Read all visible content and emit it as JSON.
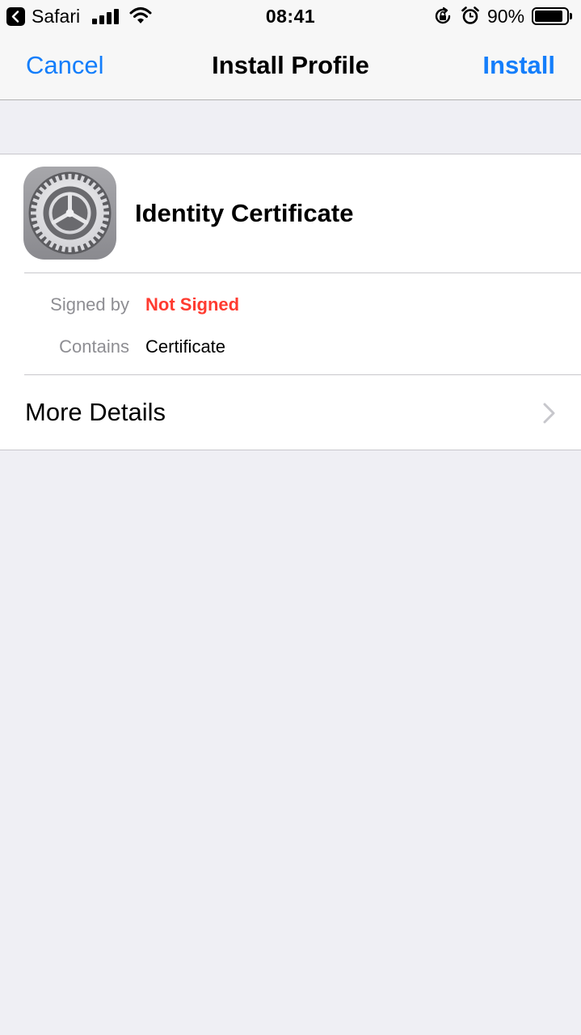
{
  "status_bar": {
    "back_app": "Safari",
    "time": "08:41",
    "battery_percent": "90%",
    "battery_level": 0.9,
    "icons": [
      "back-arrow-icon",
      "cellular-signal-icon",
      "wifi-icon",
      "orientation-lock-icon",
      "alarm-icon",
      "battery-icon"
    ]
  },
  "nav": {
    "cancel_label": "Cancel",
    "title": "Install Profile",
    "install_label": "Install"
  },
  "profile": {
    "name": "Identity Certificate",
    "icon": "settings-gear-icon"
  },
  "details": [
    {
      "label": "Signed by",
      "value": "Not Signed",
      "value_color": "#ff3b30"
    },
    {
      "label": "Contains",
      "value": "Certificate"
    }
  ],
  "more_details": {
    "label": "More Details",
    "icon": "chevron-right-icon"
  },
  "colors": {
    "accent": "#147efb",
    "warning": "#ff3b30",
    "background": "#efeff4"
  }
}
